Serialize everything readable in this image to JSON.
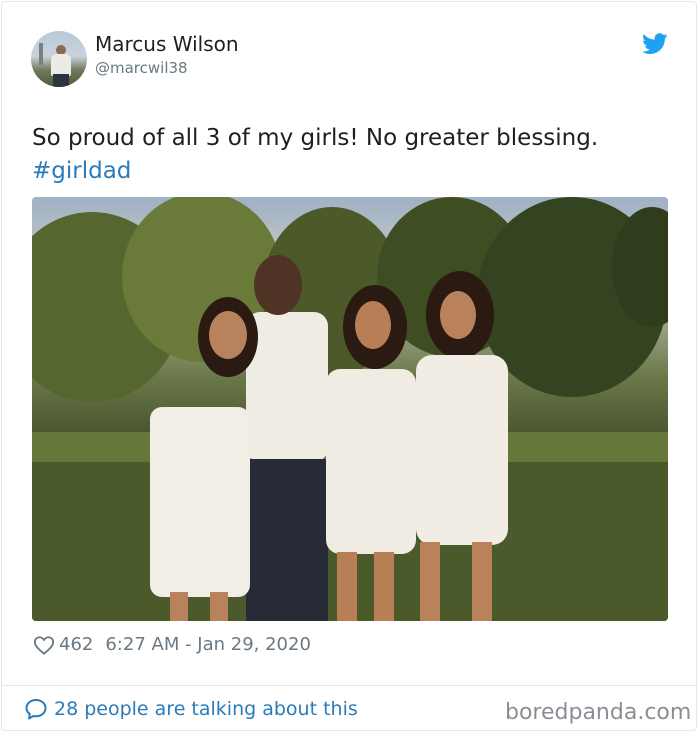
{
  "user": {
    "name": "Marcus Wilson",
    "handle": "@marcwil38"
  },
  "tweet": {
    "text": "So proud of all 3 of my girls!  No greater blessing.",
    "hashtag": "#girldad"
  },
  "meta": {
    "likes": "462",
    "timestamp": "6:27 AM - Jan 29, 2020"
  },
  "footer": {
    "talking": "28 people are talking about this"
  },
  "watermark": "boredpanda.com",
  "icons": {
    "brand": "twitter-bird-icon",
    "like": "heart-icon",
    "reply": "speech-bubble-icon"
  },
  "colors": {
    "link": "#2b7bb9",
    "muted": "#697882",
    "brand": "#1da1f2"
  }
}
